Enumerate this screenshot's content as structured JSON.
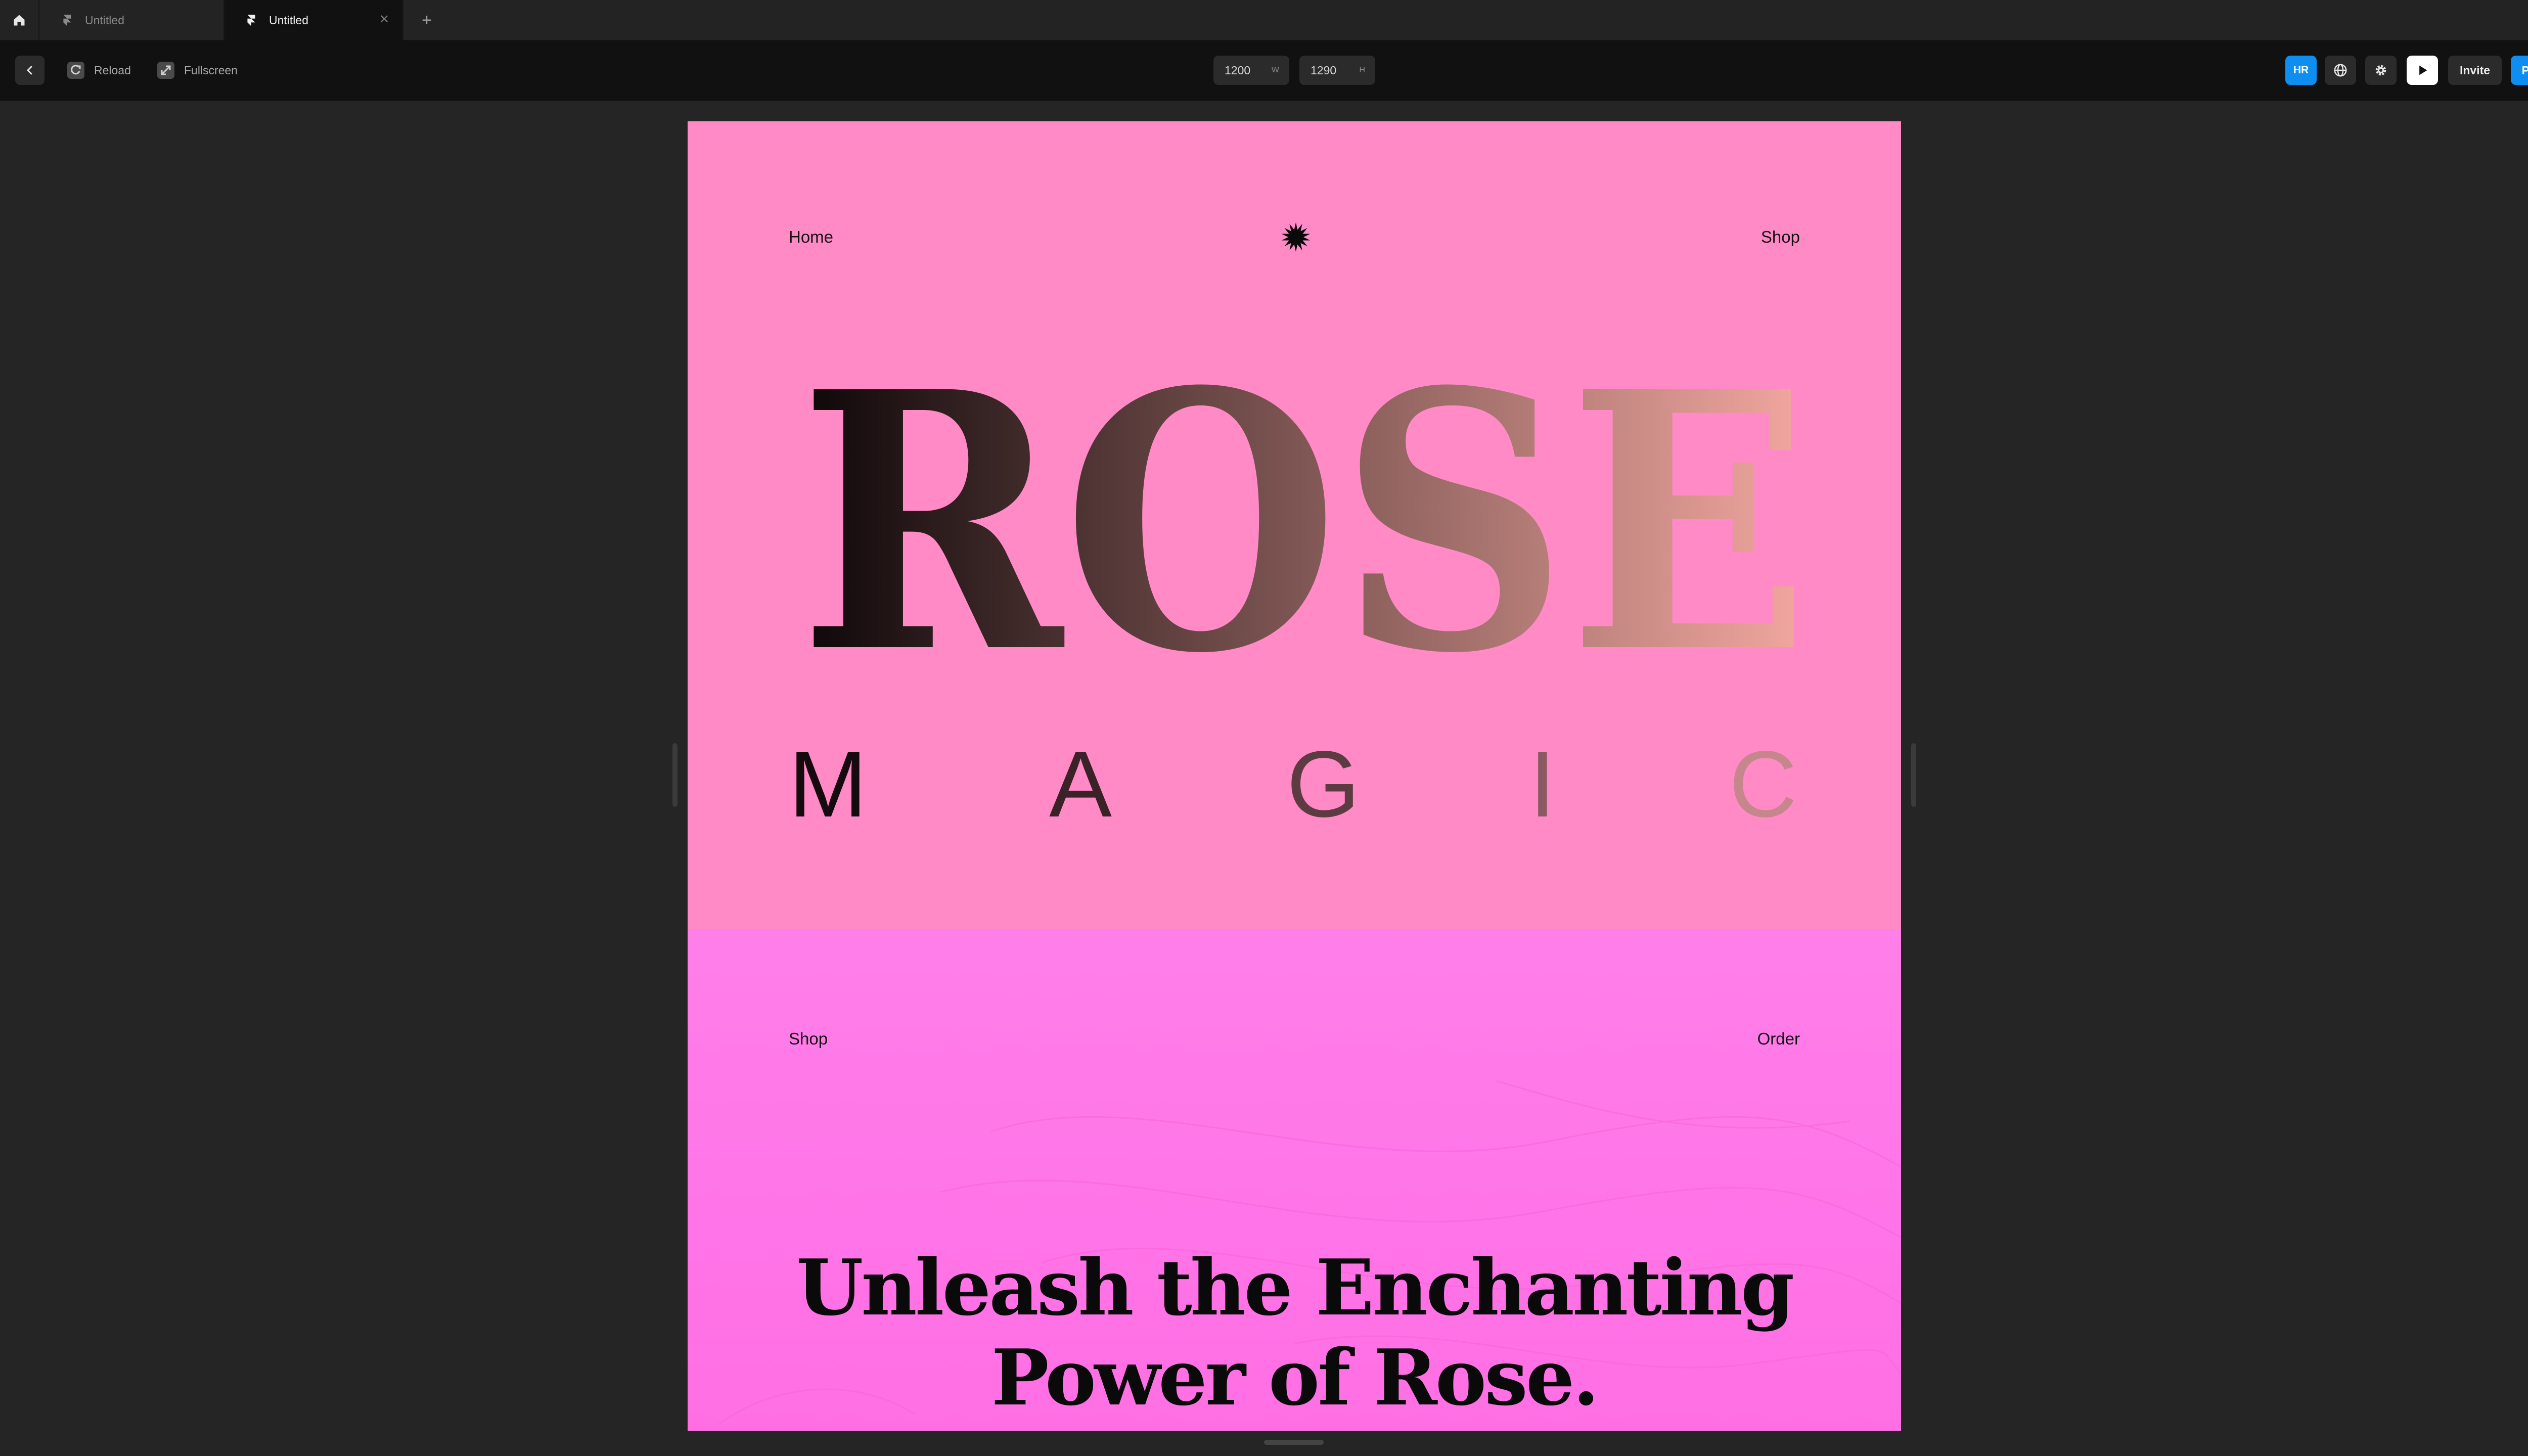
{
  "tabs": [
    {
      "label": "Untitled",
      "active": false
    },
    {
      "label": "Untitled",
      "active": true
    }
  ],
  "toolbar": {
    "reload_label": "Reload",
    "fullscreen_label": "Fullscreen",
    "width_value": "1200",
    "width_unit": "W",
    "height_value": "1290",
    "height_unit": "H",
    "avatar_initials": "HR",
    "invite_label": "Invite",
    "publish_label": "Publish"
  },
  "hero": {
    "nav_left": "Home",
    "nav_right": "Shop",
    "title": "ROSE",
    "subtitle_letters": [
      "M",
      "A",
      "G",
      "I",
      "C"
    ]
  },
  "section2": {
    "nav_left": "Shop",
    "nav_right": "Order",
    "headline_line1": "Unleash the Enchanting",
    "headline_line2": "Power of Rose."
  },
  "colors": {
    "accent_blue": "#0e8ef0",
    "hero_background": "#ff8ac6",
    "section2_background": "#ff7fe9",
    "title_gradient_start": "#0d0608",
    "title_gradient_end": "#f2a8a0"
  },
  "icons": [
    "home-icon",
    "framer-icon",
    "close-icon",
    "plus-icon",
    "chevron-left-icon",
    "reload-icon",
    "fullscreen-icon",
    "globe-icon",
    "gear-icon",
    "play-icon",
    "starburst-icon"
  ]
}
